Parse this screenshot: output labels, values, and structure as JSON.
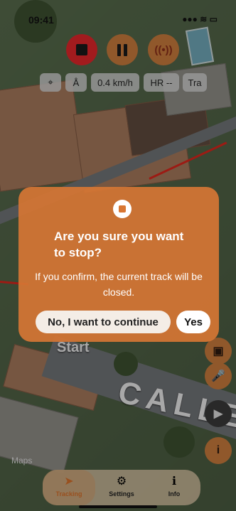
{
  "status_bar": {
    "time": "09:41",
    "icons": "●●● ≋ ▭"
  },
  "controls": {
    "stop_label": "",
    "pause_label": "",
    "signal_label": "((•))"
  },
  "pills": {
    "location_icon": "⌖",
    "person_icon": "Å",
    "speed": "0.4 km/h",
    "hr": "HR --",
    "tracking_short": "Tra"
  },
  "map": {
    "start_label": "Start",
    "street_label": "CALLE",
    "brand": "Maps"
  },
  "dialog": {
    "title": "Are you sure you want to stop?",
    "message": "If you confirm, the current track will be closed.",
    "no_label": "No, I want to continue",
    "yes_label": "Yes"
  },
  "side_buttons": {
    "mic": "🎤",
    "info": "i"
  },
  "tabbar": {
    "tabs": [
      {
        "label": "Tracking",
        "icon": "➤"
      },
      {
        "label": "Settings",
        "icon": "⚙"
      },
      {
        "label": "Info",
        "icon": "ℹ"
      }
    ]
  },
  "colors": {
    "accent": "#d97632",
    "stop_red": "#e1262a",
    "dialog_bg": "#d67634"
  }
}
